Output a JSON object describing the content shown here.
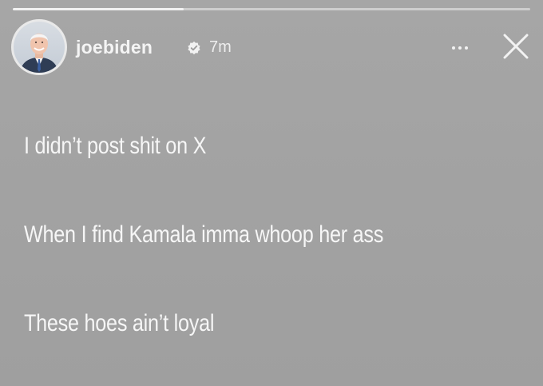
{
  "story": {
    "progress_fraction": 0.33,
    "header": {
      "username": "joebiden",
      "time": "7m",
      "verified_icon": "verified-badge-icon",
      "more_icon": "more-dots-icon",
      "close_icon": "close-icon"
    },
    "lines": [
      "I didn’t post shit on X",
      "When I find Kamala imma whoop her ass",
      "These hoes ain’t loyal"
    ]
  },
  "colors": {
    "background": "#a3a3a3",
    "text": "#f6f6f6"
  }
}
